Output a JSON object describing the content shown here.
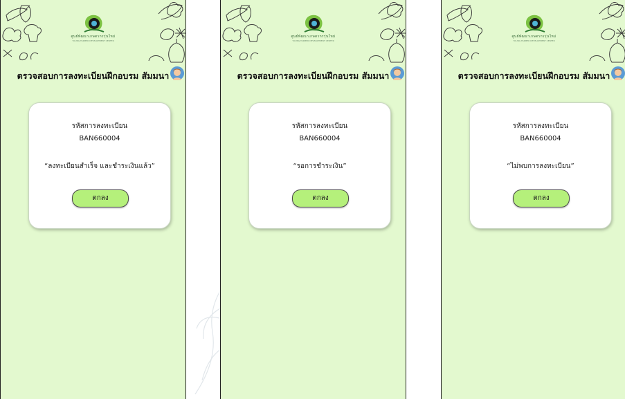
{
  "screens": [
    {
      "logo_text": "ศูนย์พัฒนาเกษตรกรรุ่นใหม่",
      "logo_sub": "YOUNG FARMER DEVELOPMENT CENTER",
      "title": "ตรวจสอบการลงทะเบียนฝึกอบรม สัมมนา",
      "card_label": "รหัสการลงทะเบียน",
      "reg_code": "BAN660004",
      "status": "“ลงทะเบียนสำเร็จ และชำระเงินแล้ว”",
      "button_label": "ตกลง"
    },
    {
      "logo_text": "ศูนย์พัฒนาเกษตรกรรุ่นใหม่",
      "logo_sub": "YOUNG FARMER DEVELOPMENT CENTER",
      "title": "ตรวจสอบการลงทะเบียนฝึกอบรม สัมมนา",
      "card_label": "รหัสการลงทะเบียน",
      "reg_code": "BAN660004",
      "status": "“รอการชำระเงิน”",
      "button_label": "ตกลง"
    },
    {
      "logo_text": "ศูนย์พัฒนาเกษตรกรรุ่นใหม่",
      "logo_sub": "YOUNG FARMER DEVELOPMENT CENTER",
      "title": "ตรวจสอบการลงทะเบียนฝึกอบรม สัมมนา",
      "card_label": "รหัสการลงทะเบียน",
      "reg_code": "BAN660004",
      "status": "“ไม่พบการลงทะเบียน”",
      "button_label": "ตกลง"
    }
  ],
  "colors": {
    "background": "#e3f9cf",
    "button": "#b5f07b",
    "card": "#ffffff"
  },
  "icons": [
    "vegetable-doodles",
    "logo-icon",
    "avatar-icon"
  ]
}
